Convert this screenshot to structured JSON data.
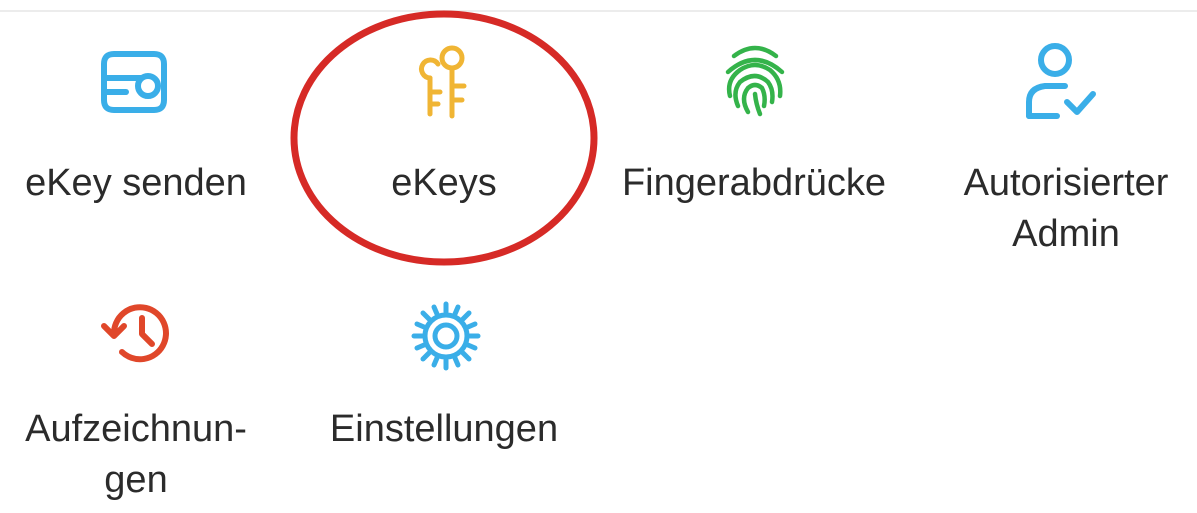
{
  "menu": {
    "items": [
      {
        "label": "eKey senden",
        "icon": "key-card-icon",
        "color": "#3aaee8"
      },
      {
        "label": "eKeys",
        "icon": "keys-icon",
        "color": "#f0b534"
      },
      {
        "label": "Fingerabdrücke",
        "icon": "fingerprint-icon",
        "color": "#34b34a"
      },
      {
        "label": "Autorisierter\nAdmin",
        "icon": "user-check-icon",
        "color": "#3aaee8"
      },
      {
        "label": "Aufzeichnun-\ngen",
        "icon": "history-icon",
        "color": "#e0472a"
      },
      {
        "label": "Einstellungen",
        "icon": "gear-icon",
        "color": "#3aaee8"
      }
    ]
  },
  "annotation": {
    "highlight_color": "#d62a26"
  }
}
